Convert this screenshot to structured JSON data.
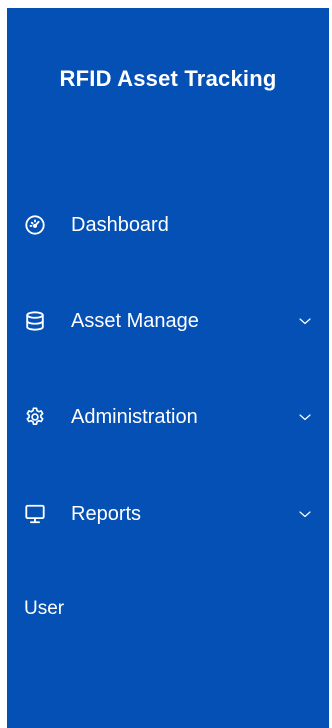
{
  "app": {
    "title": "RFID Asset Tracking"
  },
  "colors": {
    "sidebar_bg": "#0550b5",
    "text": "#ffffff"
  },
  "nav": {
    "items": [
      {
        "label": "Dashboard",
        "icon": "dashboard-gauge-icon",
        "has_submenu": false
      },
      {
        "label": "Asset Manage",
        "icon": "database-icon",
        "has_submenu": true
      },
      {
        "label": "Administration",
        "icon": "gear-icon",
        "has_submenu": true
      },
      {
        "label": "Reports",
        "icon": "monitor-icon",
        "has_submenu": true
      }
    ],
    "user_label": "User"
  }
}
